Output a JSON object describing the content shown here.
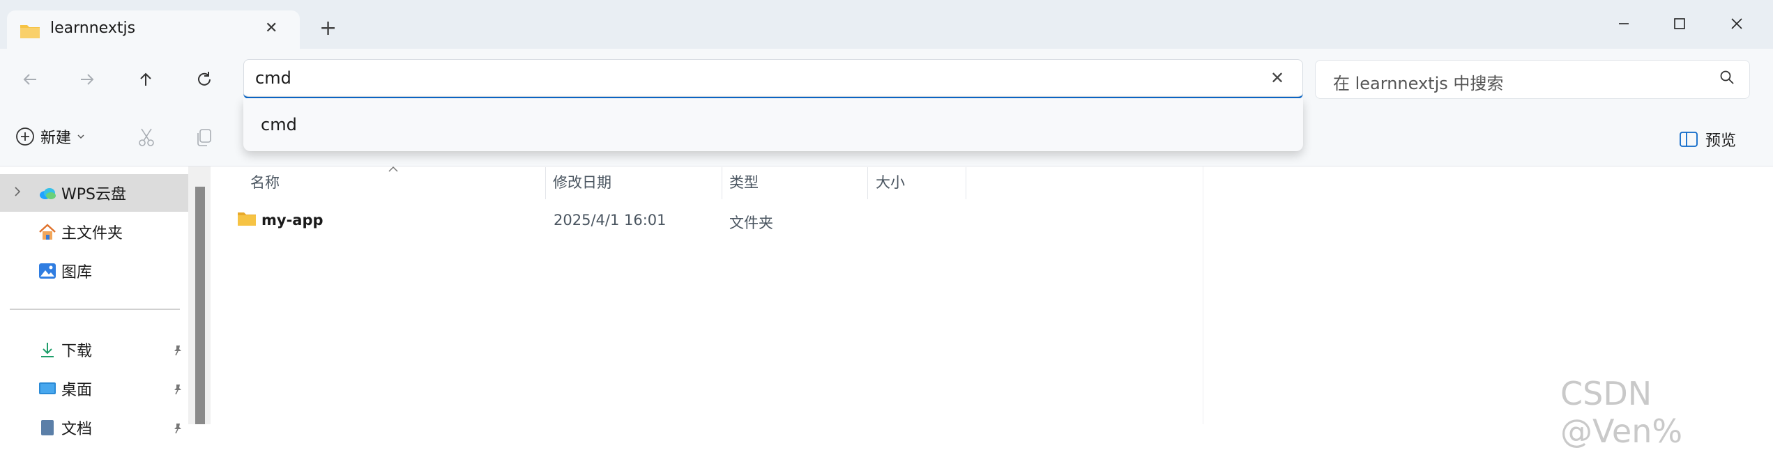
{
  "tab": {
    "title": "learnnextjs",
    "close": "✕",
    "new": "+"
  },
  "window": {
    "minimize": "—",
    "maximize": "☐",
    "close": "✕"
  },
  "address": {
    "value": "cmd",
    "clear": "✕"
  },
  "search": {
    "placeholder": "在 learnnextjs 中搜索"
  },
  "dropdown": {
    "items": [
      "cmd"
    ]
  },
  "toolbar": {
    "new_label": "新建",
    "preview_label": "预览"
  },
  "sidebar": {
    "items": [
      {
        "label": "WPS云盘",
        "icon": "cloud-icon"
      },
      {
        "label": "主文件夹",
        "icon": "home-icon"
      },
      {
        "label": "图库",
        "icon": "gallery-icon"
      },
      {
        "label": "下载",
        "icon": "download-icon",
        "pinned": true
      },
      {
        "label": "桌面",
        "icon": "desktop-icon",
        "pinned": true
      },
      {
        "label": "文档",
        "icon": "document-icon",
        "pinned": true
      }
    ]
  },
  "columns": [
    "名称",
    "修改日期",
    "类型",
    "大小"
  ],
  "files": [
    {
      "name": "my-app",
      "modified": "2025/4/1 16:01",
      "type": "文件夹",
      "size": ""
    }
  ],
  "watermark": "CSDN @Ven%",
  "colors": {
    "accent": "#0b67c8",
    "folder": "#f6c344",
    "selected": "#dcdcdc"
  }
}
